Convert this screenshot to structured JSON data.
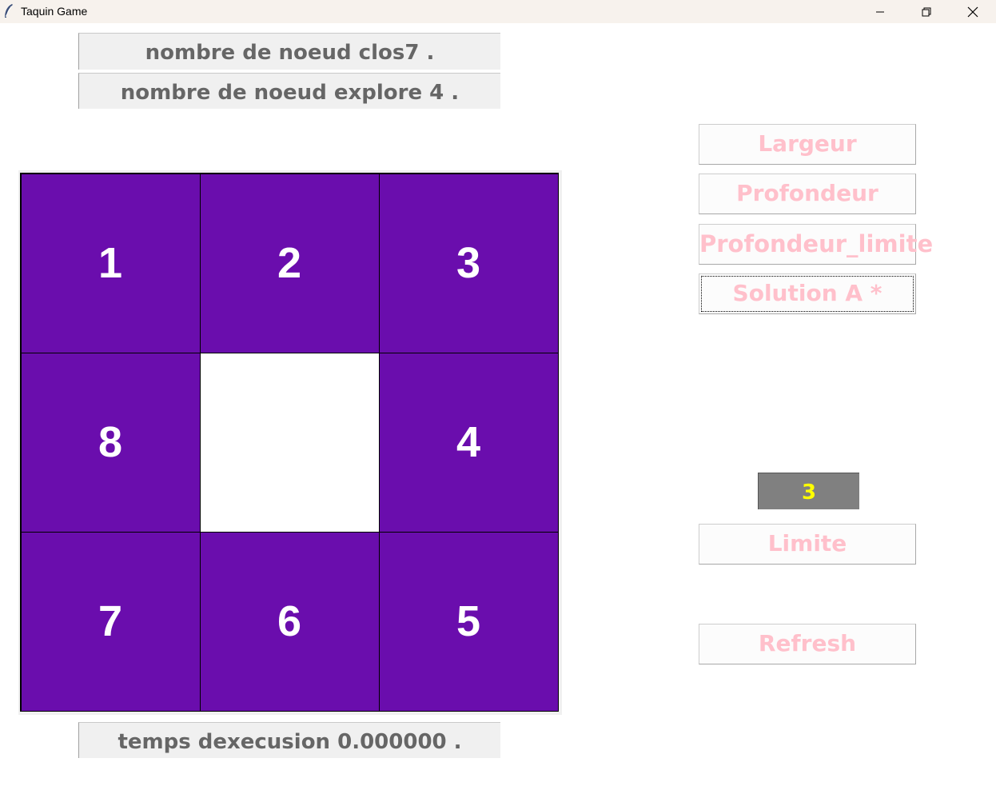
{
  "window": {
    "title": "Taquin Game",
    "controls": {
      "minimize_icon": "minimize-icon",
      "restore_icon": "restore-icon",
      "close_icon": "close-icon"
    }
  },
  "stats": {
    "closed_nodes": "nombre de noeud clos7 .",
    "explored_nodes": "nombre de noeud explore 4 .",
    "execution_time": "temps dexecusion 0.000000 ."
  },
  "board": {
    "tiles": [
      "1",
      "2",
      "3",
      "8",
      "",
      "4",
      "7",
      "6",
      "5"
    ],
    "tile_color": "#6a0dad",
    "empty_color": "#ffffff"
  },
  "controls": {
    "largeur_label": "Largeur",
    "profondeur_label": "Profondeur",
    "profondeur_limite_label": "Profondeur_limite",
    "astar_label": "Solution A *",
    "limit_value": "3",
    "limite_label": "Limite",
    "refresh_label": "Refresh"
  },
  "colors": {
    "button_text": "#ffc0cb",
    "limit_bg": "#808080",
    "limit_text": "#ffff00",
    "stat_text": "#666666"
  }
}
